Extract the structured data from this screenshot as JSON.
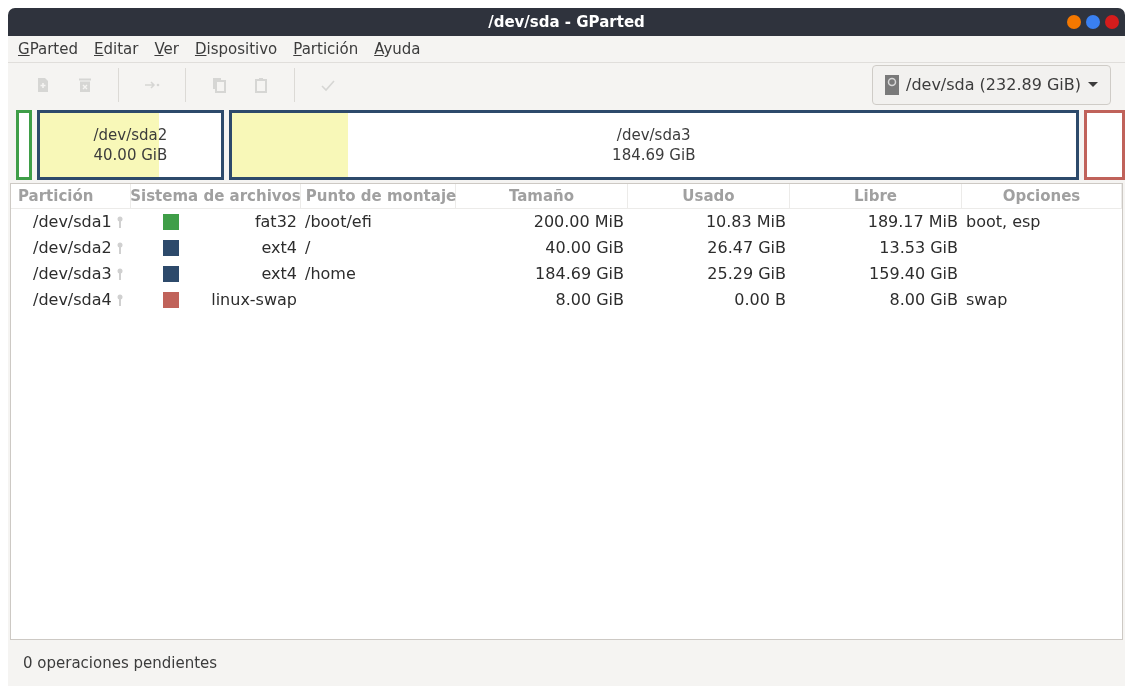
{
  "window": {
    "title": "/dev/sda - GParted"
  },
  "menu": [
    "GParted",
    "Editar",
    "Ver",
    "Dispositivo",
    "Partición",
    "Ayuda"
  ],
  "toolbar": [
    {
      "kind": "new",
      "disabled": true
    },
    {
      "kind": "delete",
      "disabled": true
    },
    {
      "kind": "resize",
      "disabled": true
    },
    {
      "kind": "copy",
      "disabled": true
    },
    {
      "kind": "paste",
      "disabled": true
    },
    {
      "kind": "apply",
      "disabled": true
    }
  ],
  "device_selector": {
    "label": "/dev/sda (232.89 GiB)"
  },
  "partition_map": [
    {
      "color": "#3f9e48"
    },
    {
      "name": "/dev/sda2",
      "size": "40.00 GiB",
      "color": "#2d4a6b",
      "level": 0.66
    },
    {
      "name": "/dev/sda3",
      "size": "184.69 GiB",
      "color": "#2d4a6b",
      "level": 0.137
    },
    {
      "color": "#c0625a"
    }
  ],
  "table": {
    "columns": [
      "Partición",
      "Sistema de archivos",
      "Punto de montaje",
      "Tamaño",
      "Usado",
      "Libre",
      "Opciones"
    ],
    "rows": [
      {
        "partition": "/dev/sda1",
        "color": "#3f9e48",
        "filesystem": "fat32",
        "mount": "/boot/efi",
        "size": "200.00 MiB",
        "used": "10.83 MiB",
        "free": "189.17 MiB",
        "options": "boot, esp"
      },
      {
        "partition": "/dev/sda2",
        "color": "#2d4a6b",
        "filesystem": "ext4",
        "mount": "/",
        "size": "40.00 GiB",
        "used": "26.47 GiB",
        "free": "13.53 GiB"
      },
      {
        "partition": "/dev/sda3",
        "color": "#2d4a6b",
        "filesystem": "ext4",
        "mount": "/home",
        "size": "184.69 GiB",
        "used": "25.29 GiB",
        "free": "159.40 GiB"
      },
      {
        "partition": "/dev/sda4",
        "color": "#c0625a",
        "filesystem": "linux-swap",
        "size": "8.00 GiB",
        "used": "0.00 B",
        "free": "8.00 GiB",
        "options": "swap"
      }
    ]
  },
  "status_bar": "0 operaciones pendientes"
}
